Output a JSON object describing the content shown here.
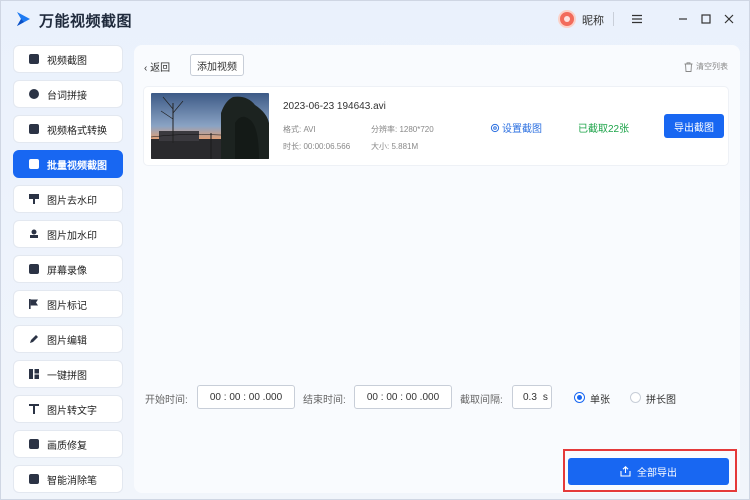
{
  "app": {
    "title": "万能视频截图",
    "user": "昵称"
  },
  "sidebar": {
    "items": [
      {
        "label": "视频截图",
        "icon": "image-icon",
        "active": false
      },
      {
        "label": "台词拼接",
        "icon": "plus-circle-icon",
        "active": false
      },
      {
        "label": "视频格式转换",
        "icon": "convert-icon",
        "active": false
      },
      {
        "label": "批量视频截图",
        "icon": "batch-image-icon",
        "active": true
      },
      {
        "label": "图片去水印",
        "icon": "brush-icon",
        "active": false
      },
      {
        "label": "图片加水印",
        "icon": "stamp-icon",
        "active": false
      },
      {
        "label": "屏幕录像",
        "icon": "screen-record-icon",
        "active": false
      },
      {
        "label": "图片标记",
        "icon": "flag-icon",
        "active": false
      },
      {
        "label": "图片编辑",
        "icon": "edit-icon",
        "active": false
      },
      {
        "label": "一键拼图",
        "icon": "collage-icon",
        "active": false
      },
      {
        "label": "图片转文字",
        "icon": "text-icon",
        "active": false
      },
      {
        "label": "画质修复",
        "icon": "picture-icon",
        "active": false
      },
      {
        "label": "智能消除笔",
        "icon": "eraser-icon",
        "active": false
      }
    ]
  },
  "toolbar": {
    "back": "返回",
    "add_video": "添加视频",
    "clear_list": "清空列表"
  },
  "file": {
    "name": "2023-06-23 194643.avi",
    "format": "格式: AVI",
    "resolution": "分辨率: 1280*720",
    "duration": "时长: 00:00:06.566",
    "size": "大小: 5.881M",
    "settings": "设置截图",
    "captured": "已截取22张",
    "export": "导出截图"
  },
  "controls": {
    "start_label": "开始时间:",
    "start_value": "00 : 00 : 00 .000",
    "end_label": "结束时间:",
    "end_value": "00 : 00 : 00 .000",
    "interval_label": "截取间隔:",
    "interval_value": "0.3",
    "interval_unit": "s",
    "mode_single": "单张",
    "mode_long": "拼长图",
    "export_all": "全部导出"
  },
  "colors": {
    "accent": "#1867f2",
    "success": "#1ea44a",
    "highlight": "#e53a3a"
  }
}
